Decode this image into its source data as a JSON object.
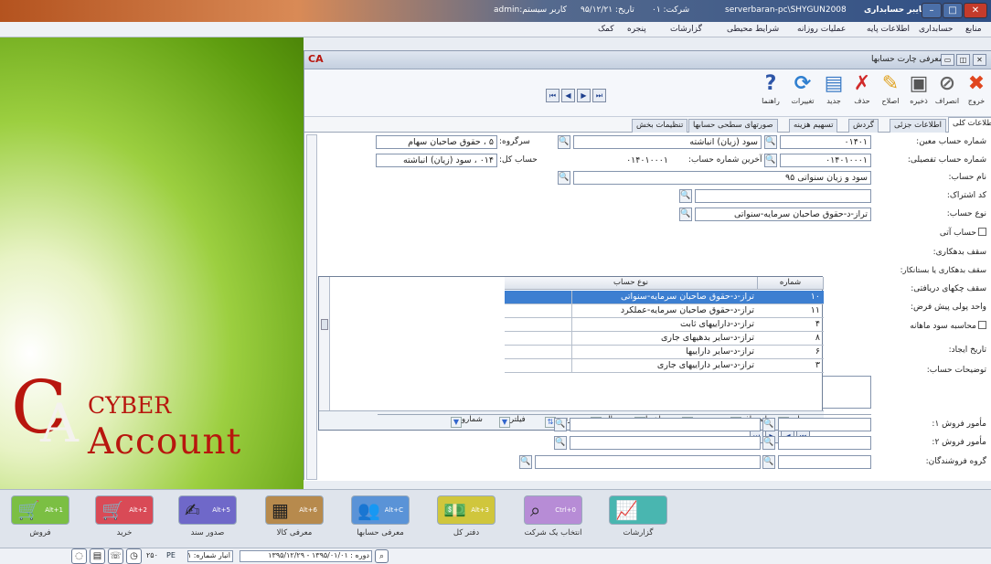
{
  "titlebar": {
    "user": "admin:کاربر سیستم",
    "date": "۹۵/۱۲/۲۱ :تاریخ",
    "company": "۰۱ :شرکت",
    "server": "serverbaran-pc\\SHYGUN2008",
    "app": "سایبر حسابداری"
  },
  "menu": [
    "منابع",
    "حسابداری",
    "اطلاعات پایه",
    "عملیات روزانه",
    "شرایط محیطی",
    "گزارشات",
    "پنجره",
    "کمک"
  ],
  "doc": {
    "title": "معرفی چارت حسابها"
  },
  "toolbar": {
    "buttons": [
      {
        "label": "خروج",
        "icon": "close-icon"
      },
      {
        "label": "انصراف",
        "icon": "cancel-icon"
      },
      {
        "label": "ذخیره",
        "icon": "save-icon"
      },
      {
        "label": "اصلاح",
        "icon": "edit-icon"
      },
      {
        "label": "حذف",
        "icon": "delete-icon"
      },
      {
        "label": "جدید",
        "icon": "new-icon"
      },
      {
        "label": "تغییرات",
        "icon": "refresh-icon"
      },
      {
        "label": "راهنما",
        "icon": "help-icon"
      }
    ]
  },
  "tabs": [
    "اطلاعات کلی",
    "اطلاعات جزئی",
    "گردش",
    "تسهیم هزینه",
    "صورتهای سطحی حسابها",
    "تنظیمات بخش"
  ],
  "form": {
    "account_code_label": "شماره حساب معین:",
    "account_code": "۰۱۴۰۱",
    "account_name": "سود (زیان) انباشته",
    "detail_code_label": "شماره حساب تفصیلی:",
    "detail_code": "۰۱۴۰۱۰۰۰۱",
    "last_code_label": "آخرین شماره حساب:",
    "last_code": "۰۱۴۰۱۰۰۰۱",
    "group_label": "سرگروه:",
    "group_value": "۵ ، حقوق صاحبان سهام",
    "general_label": "حساب کل:",
    "general_value": "۰۱۴ ، سود (زیان) انباشته",
    "name_label": "نام حساب:",
    "name_value": "سود و زیان سنواتی ۹۵",
    "sharing_label": "کد اشتراک:",
    "type_label": "نوع حساب:",
    "type_value": "تراز-د-حقوق صاحبان سرمایه-سنواتی",
    "float_label": "حساب آتی",
    "credit_label": "سقف بدهکاری:",
    "debit_limit_label": "سقف بدهکاری یا بستانکار:",
    "checks_label": "سقف چکهای دریافتی:",
    "currency_label": "واحد پولی پیش فرض:",
    "calc_label": "محاسبه سود ماهانه",
    "date_label": "تاریخ ایجاد:",
    "desc_label": "توضیحات حساب:",
    "sales1_label": "مأمور فروش ۱:",
    "sales2_label": "مأمور فروش ۲:",
    "sellers_label": "گروه فروشندگان:"
  },
  "grid": {
    "headers": [
      "شماره",
      "نوع حساب"
    ],
    "rows": [
      [
        "۱۰",
        "تراز-د-حقوق صاحبان سرمایه-سنواتی"
      ],
      [
        "۱۱",
        "تراز-د-حقوق صاحبان سرمایه-عملکرد"
      ],
      [
        "۴",
        "تراز-د-داراییهای ثابت"
      ],
      [
        "۸",
        "تراز-د-سایر بدهیهای جاری"
      ],
      [
        "۶",
        "تراز-د-سایر داراییها"
      ],
      [
        "۳",
        "تراز-د-سایر داراییهای جاری"
      ]
    ],
    "footer": [
      "تایید",
      "انصراف",
      "جستجو",
      "راهنما",
      "حالی",
      "ترتیب",
      "فیلتر",
      "شمارو"
    ]
  },
  "bottom": [
    {
      "label": "فروش",
      "hotkey": "Alt+1",
      "color": "#7bbf43"
    },
    {
      "label": "خرید",
      "hotkey": "Alt+2",
      "color": "#d94a56"
    },
    {
      "label": "صدور سند",
      "hotkey": "Alt+5",
      "color": "#6f68c9"
    },
    {
      "label": "معرفی کالا",
      "hotkey": "Alt+6",
      "color": "#b78a4d"
    },
    {
      "label": "معرفی حسابها",
      "hotkey": "Alt+C",
      "color": "#5a93d7"
    },
    {
      "label": "دفتر کل",
      "hotkey": "Alt+3",
      "color": "#d0c63c"
    },
    {
      "label": "انتخاب یک شرکت",
      "hotkey": "Ctrl+0",
      "color": "#b78cd6"
    },
    {
      "label": "گزارشات",
      "hotkey": "",
      "color": "#49b6b0"
    }
  ],
  "status": {
    "warehouse": "انبار شماره: ۱",
    "period": "دوره : ۱۳۹۵/۰۱/۰۱ - ۱۳۹۵/۱۲/۲۹",
    "lang1": "PE",
    "lang2": "۲۵۰"
  }
}
